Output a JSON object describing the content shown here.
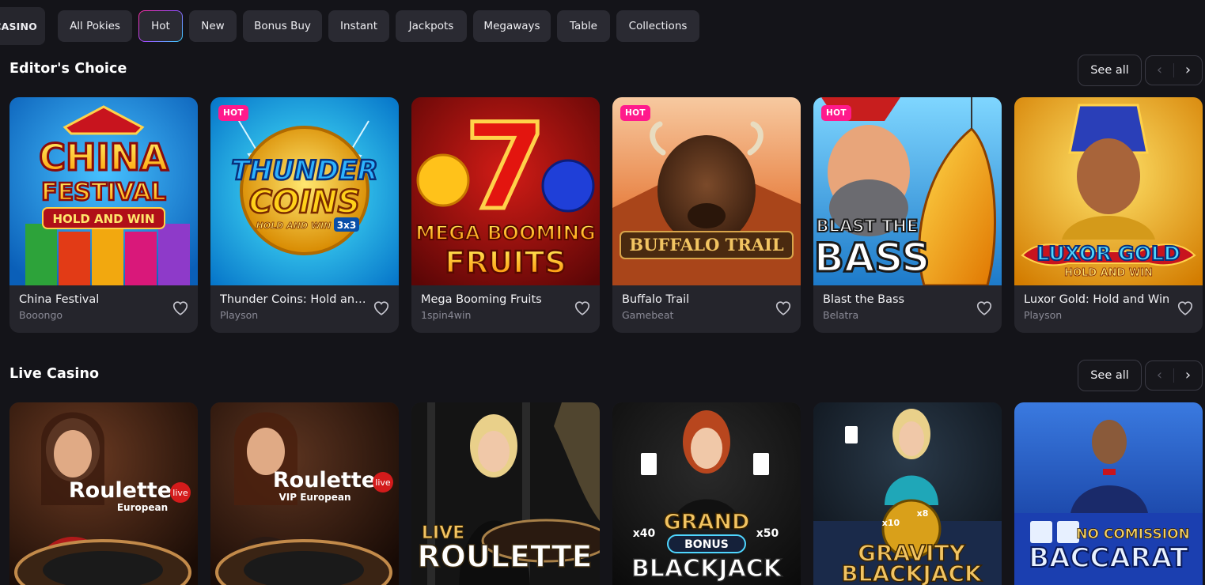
{
  "categories": [
    {
      "label": "CASINO"
    },
    {
      "label": "All Pokies"
    },
    {
      "label": "Hot"
    },
    {
      "label": "New"
    },
    {
      "label": "Bonus Buy"
    },
    {
      "label": "Instant"
    },
    {
      "label": "Jackpots"
    },
    {
      "label": "Megaways"
    },
    {
      "label": "Table"
    },
    {
      "label": "Collections"
    }
  ],
  "active_category": "Hot",
  "sections": {
    "editors_choice": {
      "title": "Editor's Choice",
      "see_all": "See all",
      "games": [
        {
          "name": "China Festival",
          "provider": "Booongo",
          "hot": "",
          "art": [
            "CHINA",
            "FESTIVAL",
            "HOLD AND WIN"
          ]
        },
        {
          "name": "Thunder Coins: Hold and Win",
          "provider": "Playson",
          "hot": "HOT",
          "art": [
            "THUNDER",
            "COINS",
            "HOLD AND WIN",
            "3x3"
          ]
        },
        {
          "name": "Mega Booming Fruits",
          "provider": "1spin4win",
          "hot": "",
          "art": [
            "7",
            "MEGA BOOMING",
            "FRUITS"
          ]
        },
        {
          "name": "Buffalo Trail",
          "provider": "Gamebeat",
          "hot": "HOT",
          "art": [
            "BUFFALO TRAIL"
          ]
        },
        {
          "name": "Blast the Bass",
          "provider": "Belatra",
          "hot": "HOT",
          "art": [
            "BLAST THE",
            "BASS"
          ]
        },
        {
          "name": "Luxor Gold: Hold and Win",
          "provider": "Playson",
          "hot": "",
          "art": [
            "LUXOR GOLD",
            "HOLD AND WIN"
          ]
        }
      ]
    },
    "live_casino": {
      "title": "Live Casino",
      "see_all": "See all",
      "games": [
        {
          "art": [
            "Roulette",
            "live",
            "European"
          ]
        },
        {
          "art": [
            "Roulette",
            "live",
            "VIP European"
          ]
        },
        {
          "art": [
            "LIVE",
            "ROULETTE"
          ]
        },
        {
          "art": [
            "GRAND",
            "BONUS",
            "BLACKJACK",
            "x40",
            "x50"
          ]
        },
        {
          "art": [
            "GRAVITY",
            "BLACKJACK",
            "x10",
            "x8"
          ]
        },
        {
          "art": [
            "NO COMISSION",
            "BACCARAT"
          ]
        }
      ]
    }
  },
  "icons": {
    "heart": "heart-icon",
    "prev": "chevron-left-icon",
    "next": "chevron-right-icon"
  },
  "colors": {
    "background": "#141419",
    "card": "#25252c",
    "hot_badge": "#ff1a8c",
    "chip": "#2a2a32"
  }
}
